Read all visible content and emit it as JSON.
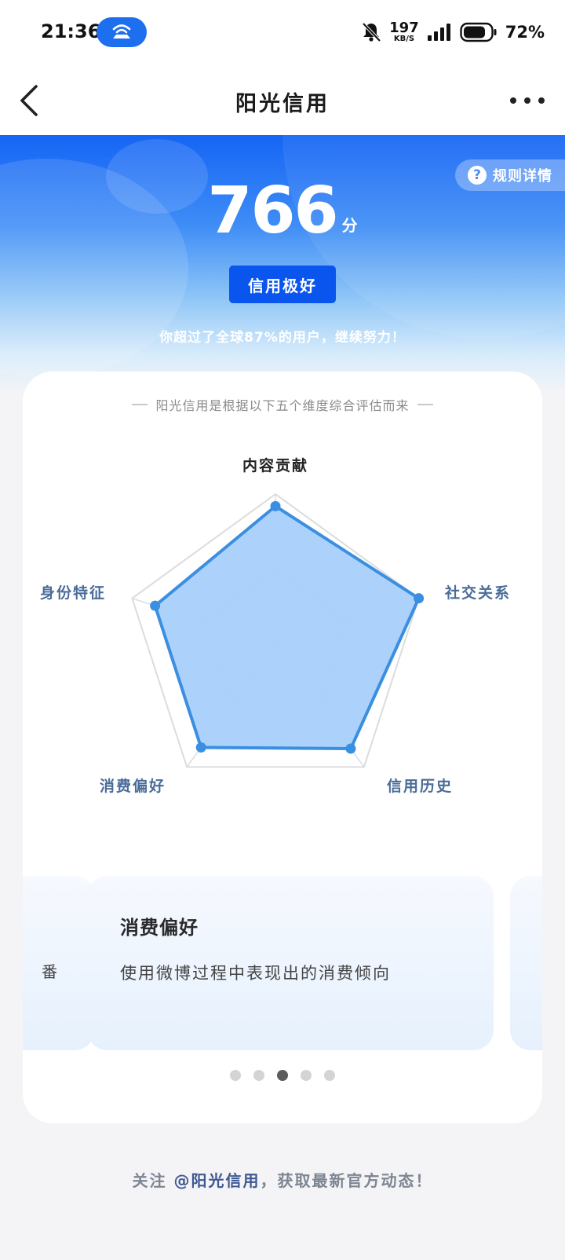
{
  "status_bar": {
    "time": "21:36",
    "net_speed": "197",
    "net_unit": "KB/S",
    "battery": "72%"
  },
  "nav": {
    "title": "阳光信用"
  },
  "hero": {
    "rules_link": "规则详情",
    "help_glyph": "?",
    "score": "766",
    "score_unit": "分",
    "level": "信用极好",
    "rank_text": "你超过了全球87%的用户，继续努力！"
  },
  "card": {
    "intro": "阳光信用是根据以下五个维度综合评估而来"
  },
  "radar": {
    "axes": [
      "内容贡献",
      "社交关系",
      "信用历史",
      "消费偏好",
      "身份特征"
    ],
    "levels": [
      0.92,
      1.0,
      0.85,
      0.84,
      0.84
    ],
    "colors": {
      "fill": "#a8d0fb",
      "stroke": "#3a8fe0",
      "top_label": "#222222",
      "axis_label": "#4a6c99"
    }
  },
  "dimension_cards": {
    "left_peek_char": "番",
    "active": {
      "title": "消费偏好",
      "desc": "使用微博过程中表现出的消费倾向"
    }
  },
  "pager": {
    "count": 5,
    "active_index": 2
  },
  "footer": {
    "prefix": "关注 ",
    "handle": "@阳光信用",
    "suffix": "，获取最新官方动态！"
  }
}
